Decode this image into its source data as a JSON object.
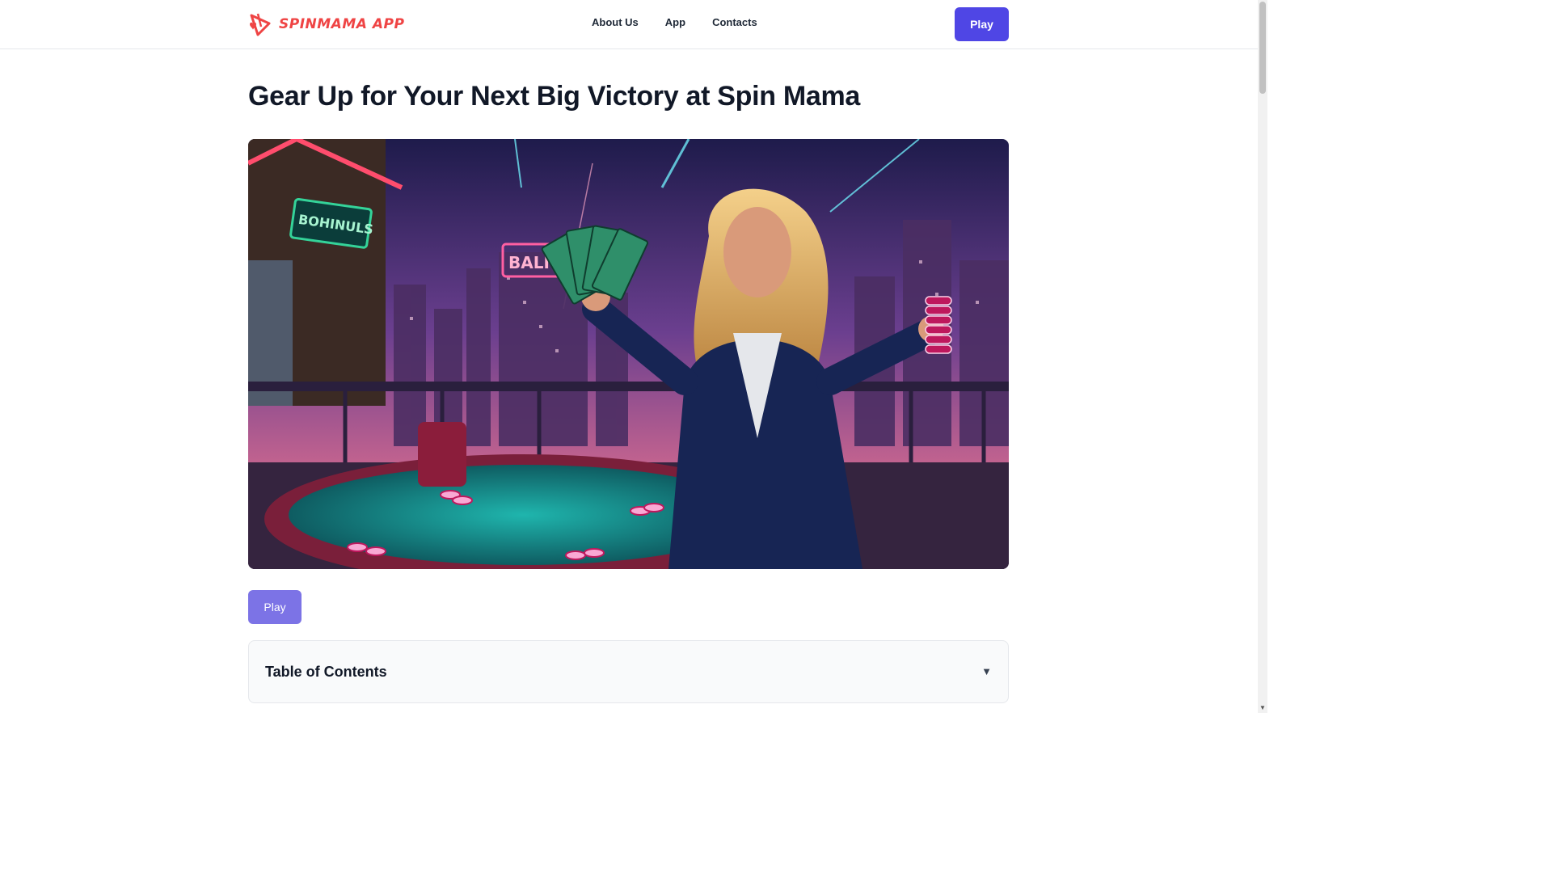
{
  "header": {
    "logo_text": "SPINMAMA APP",
    "nav": [
      {
        "label": "About Us"
      },
      {
        "label": "App"
      },
      {
        "label": "Contacts"
      }
    ],
    "play_label": "Play"
  },
  "main": {
    "title": "Gear Up for Your Next Big Victory at Spin Mama",
    "hero_sign": "BOHINULS",
    "hero_neon": "BALI",
    "play_label": "Play",
    "toc": {
      "title": "Table of Contents",
      "caret": "▼"
    }
  },
  "colors": {
    "brand_red": "#ef4444",
    "accent": "#4f46e5",
    "accent_light": "#7c73e6"
  }
}
